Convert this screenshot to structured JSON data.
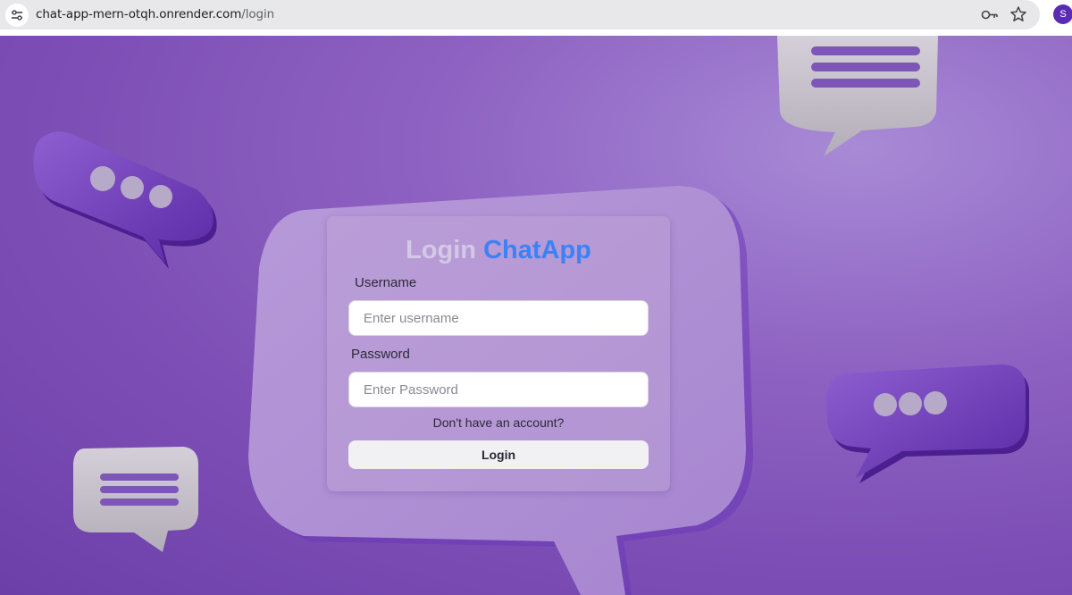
{
  "browser": {
    "url_host": "chat-app-mern-otqh.onrender.com",
    "url_path": "/login",
    "profile_initial": "S",
    "icons": [
      "site-info-icon",
      "password-key-icon",
      "bookmark-star-icon"
    ]
  },
  "login": {
    "title_part1": "Login",
    "title_part2": "ChatApp",
    "username_label": "Username",
    "username_placeholder": "Enter username",
    "password_label": "Password",
    "password_placeholder": "Enter Password",
    "signup_link": "Don't have an account?",
    "login_button": "Login"
  },
  "colors": {
    "accent": "#3b82f6",
    "background": "#8e62c2",
    "profile": "#5b2bb5"
  }
}
